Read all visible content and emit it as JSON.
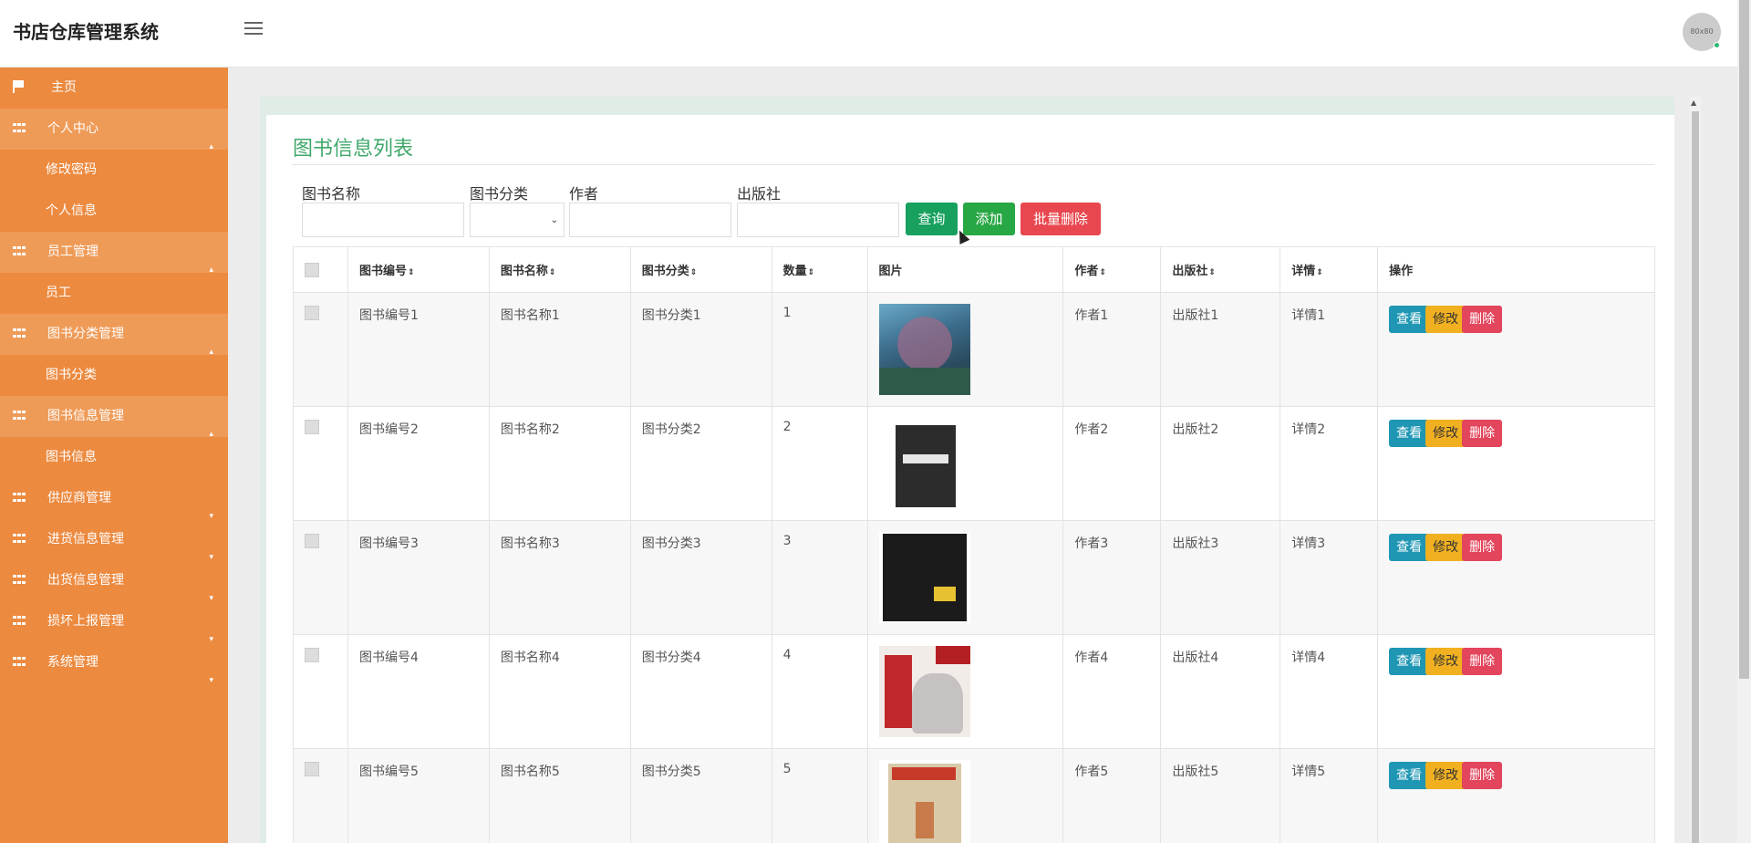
{
  "app": {
    "title": "书店仓库管理系统",
    "avatar_text": "80x80"
  },
  "sidebar": {
    "home": "主页",
    "groups": [
      {
        "label": "个人中心",
        "items": [
          "修改密码",
          "个人信息"
        ]
      },
      {
        "label": "员工管理",
        "items": [
          "员工"
        ]
      },
      {
        "label": "图书分类管理",
        "items": [
          "图书分类"
        ]
      },
      {
        "label": "图书信息管理",
        "items": [
          "图书信息"
        ]
      }
    ],
    "collapsed": [
      "供应商管理",
      "进货信息管理",
      "出货信息管理",
      "损坏上报管理",
      "系统管理"
    ]
  },
  "page": {
    "title": "图书信息列表"
  },
  "filters": {
    "name_label": "图书名称",
    "category_label": "图书分类",
    "author_label": "作者",
    "publisher_label": "出版社"
  },
  "buttons": {
    "search": "查询",
    "add": "添加",
    "batch_delete": "批量删除"
  },
  "table": {
    "headers": [
      "图书编号",
      "图书名称",
      "图书分类",
      "数量",
      "图片",
      "作者",
      "出版社",
      "详情",
      "操作"
    ],
    "rows": [
      {
        "id": "图书编号1",
        "name": "图书名称1",
        "category": "图书分类1",
        "qty": "1",
        "author": "作者1",
        "publisher": "出版社1",
        "detail": "详情1"
      },
      {
        "id": "图书编号2",
        "name": "图书名称2",
        "category": "图书分类2",
        "qty": "2",
        "author": "作者2",
        "publisher": "出版社2",
        "detail": "详情2"
      },
      {
        "id": "图书编号3",
        "name": "图书名称3",
        "category": "图书分类3",
        "qty": "3",
        "author": "作者3",
        "publisher": "出版社3",
        "detail": "详情3"
      },
      {
        "id": "图书编号4",
        "name": "图书名称4",
        "category": "图书分类4",
        "qty": "4",
        "author": "作者4",
        "publisher": "出版社4",
        "detail": "详情4"
      },
      {
        "id": "图书编号5",
        "name": "图书名称5",
        "category": "图书分类5",
        "qty": "5",
        "author": "作者5",
        "publisher": "出版社5",
        "detail": "详情5"
      }
    ],
    "actions": {
      "view": "查看",
      "edit": "修改",
      "delete": "删除"
    }
  },
  "colors": {
    "sidebar": "#ec8a3f",
    "title": "#3fa86b",
    "view": "#1f97b4",
    "edit": "#f0b020",
    "delete": "#e2455c"
  }
}
